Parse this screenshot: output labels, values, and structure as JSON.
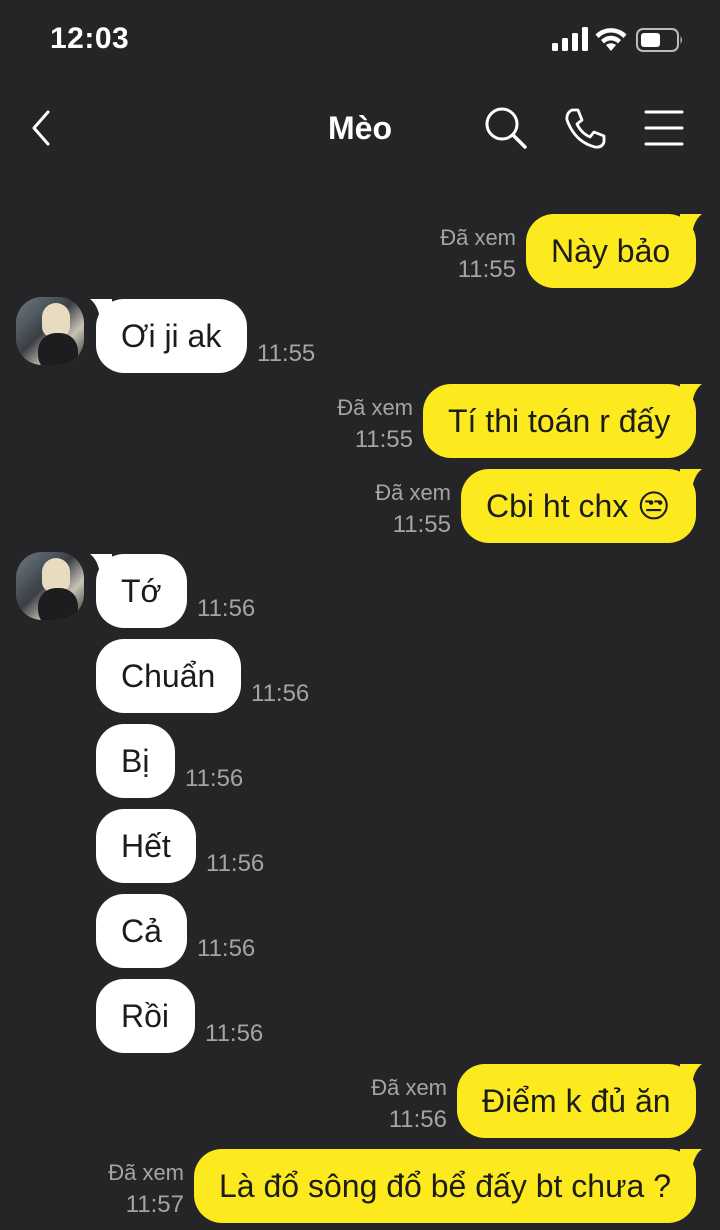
{
  "status": {
    "time": "12:03"
  },
  "header": {
    "title": "Mèo",
    "icons": [
      "back-icon",
      "search-icon",
      "phone-icon",
      "menu-icon"
    ]
  },
  "colors": {
    "background": "#252527",
    "outgoing_bubble": "#fdea1e",
    "incoming_bubble": "#ffffff",
    "meta_text": "#a4a4a6"
  },
  "messages": [
    {
      "dir": "out",
      "text": "Này bảo",
      "seen": "Đã xem",
      "time": "11:55"
    },
    {
      "dir": "in",
      "text": "Ơi ji ak",
      "time": "11:55",
      "avatar": true
    },
    {
      "dir": "out",
      "text": "Tí thi toán r đấy",
      "seen": "Đã xem",
      "time": "11:55"
    },
    {
      "dir": "out",
      "text": "Cbi ht chx 😒",
      "seen": "Đã xem",
      "time": "11:55"
    },
    {
      "dir": "in",
      "text": "Tớ",
      "time": "11:56",
      "avatar": true
    },
    {
      "dir": "in",
      "text": "Chuẩn",
      "time": "11:56"
    },
    {
      "dir": "in",
      "text": "Bị",
      "time": "11:56"
    },
    {
      "dir": "in",
      "text": "Hết",
      "time": "11:56"
    },
    {
      "dir": "in",
      "text": "Cả",
      "time": "11:56"
    },
    {
      "dir": "in",
      "text": "Rồi",
      "time": "11:56"
    },
    {
      "dir": "out",
      "text": "Điểm k đủ ăn",
      "seen": "Đã xem",
      "time": "11:56"
    },
    {
      "dir": "out",
      "text": "Là đổ sông đổ bể đấy bt chưa ?",
      "seen": "Đã xem",
      "time": "11:57"
    }
  ]
}
